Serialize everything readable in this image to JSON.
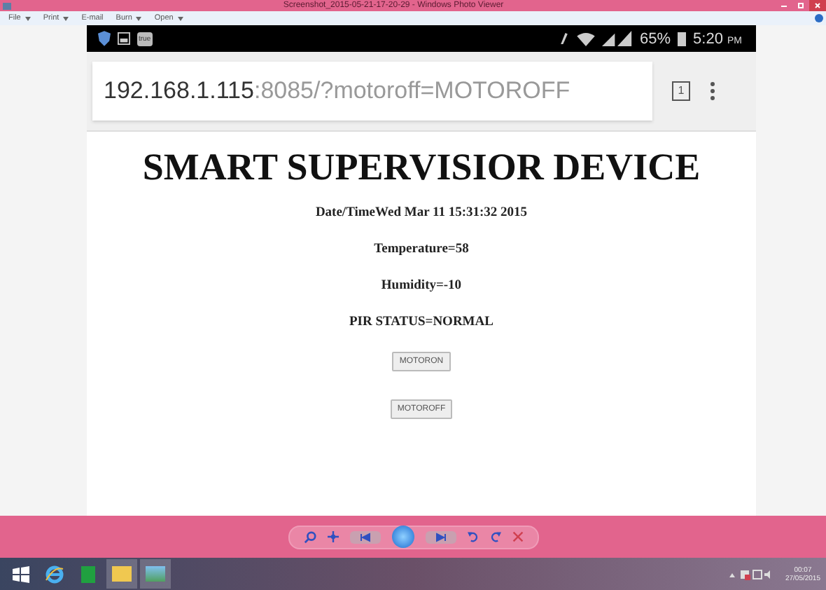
{
  "window": {
    "title": "Screenshot_2015-05-21-17-20-29 - Windows Photo Viewer"
  },
  "menu": [
    {
      "label": "File",
      "dropdown": true
    },
    {
      "label": "Print",
      "dropdown": true
    },
    {
      "label": "E-mail",
      "dropdown": false
    },
    {
      "label": "Burn",
      "dropdown": true
    },
    {
      "label": "Open",
      "dropdown": true
    }
  ],
  "phone": {
    "status_bar": {
      "app_badge": "true",
      "battery": "65%",
      "time": "5:20",
      "ampm": "PM"
    },
    "address_bar": {
      "host": "192.168.1.115",
      "path": ":8085/?motoroff=MOTOROFF",
      "tab_count": "1"
    },
    "page": {
      "heading": "SMART SUPERVISIOR DEVICE",
      "lines": [
        "Date/TimeWed Mar 11 15:31:32 2015",
        "Temperature=58",
        "Humidity=-10",
        "PIR STATUS=NORMAL"
      ],
      "buttons": [
        "MOTORON",
        "MOTOROFF"
      ]
    }
  },
  "taskbar": {
    "time": "00:07",
    "date": "27/05/2015"
  }
}
